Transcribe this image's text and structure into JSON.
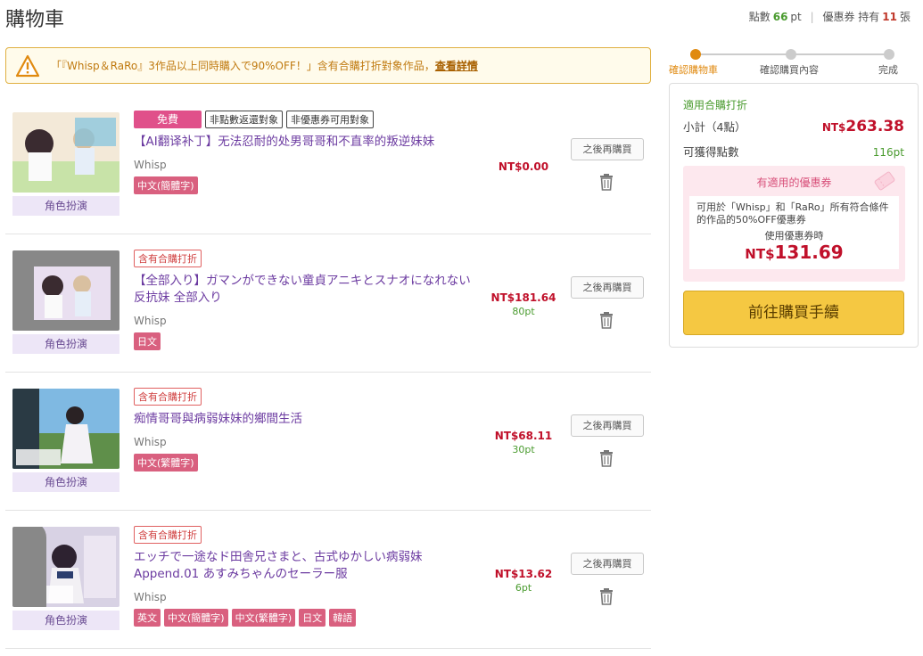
{
  "header": {
    "title": "購物車",
    "points_label": "點數",
    "points_value": "66",
    "points_unit": "pt",
    "coupon_label": "優惠券 持有",
    "coupon_value": "11",
    "coupon_unit": "張"
  },
  "notice": {
    "text": "「『Whisp＆RaRo』3作品以上同時購入で90%OFF！」含有合購打折對象作品，",
    "link": "查看詳情"
  },
  "items": [
    {
      "badges": [
        "免費",
        "非點數返還對象",
        "非優惠券可用對象"
      ],
      "discount_badge": "",
      "title": "【AI翻译补丁】无法忍耐的处男哥哥和不直率的叛逆妹妹",
      "maker": "Whisp",
      "langs": [
        "中文(簡體字)"
      ],
      "price": "NT$0.00",
      "points": "",
      "later": "之後再購買",
      "thumb_label": "角色扮演"
    },
    {
      "badges": [],
      "discount_badge": "含有合購打折",
      "title": "【全部入り】ガマンができない童貞アニキとスナオになれない反抗妹 全部入り",
      "maker": "Whisp",
      "langs": [
        "日文"
      ],
      "price": "NT$181.64",
      "points": "80pt",
      "later": "之後再購買",
      "thumb_label": "角色扮演"
    },
    {
      "badges": [],
      "discount_badge": "含有合購打折",
      "title": "痴情哥哥與病弱妹妹的鄉間生活",
      "maker": "Whisp",
      "langs": [
        "中文(繁體字)"
      ],
      "price": "NT$68.11",
      "points": "30pt",
      "later": "之後再購買",
      "thumb_label": "角色扮演"
    },
    {
      "badges": [],
      "discount_badge": "含有合購打折",
      "title": "エッチで一途なド田舎兄さまと、古式ゆかしい病弱妹 Append.01 あすみちゃんのセーラー服",
      "maker": "Whisp",
      "langs": [
        "英文",
        "中文(簡體字)",
        "中文(繁體字)",
        "日文",
        "韓語"
      ],
      "price": "NT$13.62",
      "points": "6pt",
      "later": "之後再購買",
      "thumb_label": "角色扮演"
    }
  ],
  "steps": [
    "確認購物車",
    "確認購買內容",
    "完成"
  ],
  "summary": {
    "head": "適用合購打折",
    "subtotal_label": "小計（4點）",
    "subtotal_currency": "NT$",
    "subtotal_value": "263.38",
    "points_label": "可獲得點數",
    "points_value": "116pt",
    "coupon_title": "有適用的優惠券",
    "coupon_desc": "可用於「Whisp」和「RaRo」所有符合條件的作品的50%OFF優惠券",
    "coupon_use": "使用優惠券時",
    "coupon_currency": "NT$",
    "coupon_value": "131.69",
    "buy_label": "前往購買手續"
  },
  "colors": {
    "accent": "#e08a10",
    "price": "#c0102a",
    "points": "#4a9b2f",
    "title": "#6b3aa0",
    "buy_button": "#f5c842"
  }
}
